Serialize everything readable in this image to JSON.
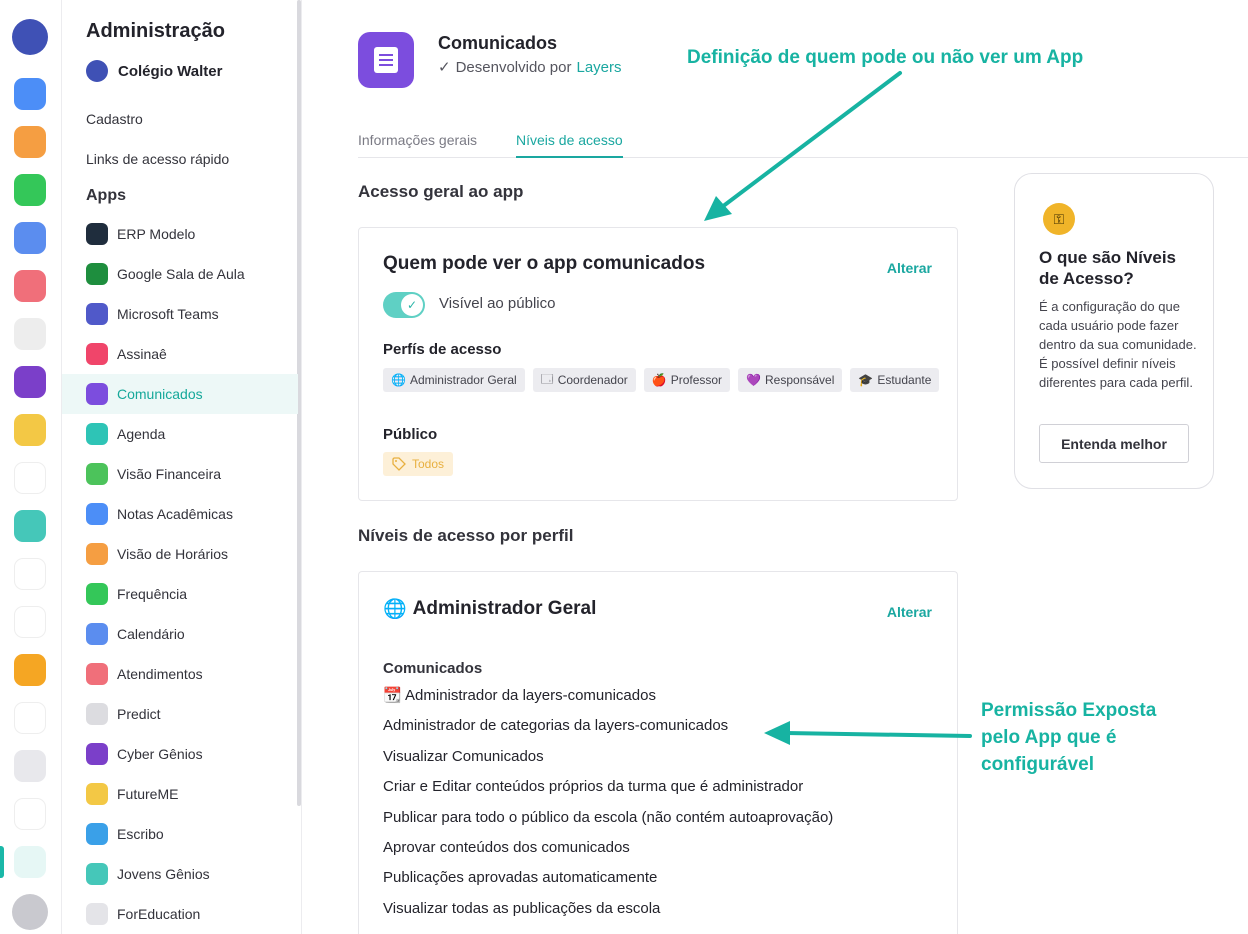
{
  "rail": {
    "icons": [
      {
        "name": "school-switch-icon",
        "color": "#3f51b5"
      },
      {
        "name": "star-app-icon",
        "color": "#4c8ef7"
      },
      {
        "name": "clock-app-icon",
        "color": "#f59e42"
      },
      {
        "name": "check-app-icon",
        "color": "#34c759"
      },
      {
        "name": "calendar-app-icon",
        "color": "#5b8def"
      },
      {
        "name": "chat-app-icon",
        "color": "#f06f7a"
      },
      {
        "name": "predict-app-icon",
        "color": "#ededed"
      },
      {
        "name": "cyber-app-icon",
        "color": "#7b3fc9"
      },
      {
        "name": "futureme-app-icon",
        "color": "#f3c845"
      },
      {
        "name": "play-app-icon",
        "color": "#ffffff"
      },
      {
        "name": "jovens-app-icon",
        "color": "#45c7b9"
      },
      {
        "name": "foreducation-app-icon",
        "color": "#ffffff"
      },
      {
        "name": "redigir-app-icon",
        "color": "#ffffff"
      },
      {
        "name": "arrow-app-icon",
        "color": "#f5a623"
      },
      {
        "name": "orbit-app-icon",
        "color": "#ffffff"
      },
      {
        "name": "folder-icon",
        "color": "#e8e8ec"
      },
      {
        "name": "apps-grid-icon",
        "color": "#ffffff"
      },
      {
        "name": "gear-icon",
        "color": "#e6f7f5"
      },
      {
        "name": "avatar-icon",
        "color": "#c9c9cf"
      }
    ]
  },
  "sidebar": {
    "title": "Administração",
    "school": "Colégio Walter",
    "links": [
      "Cadastro",
      "Links de acesso rápido"
    ],
    "apps_heading": "Apps",
    "apps": [
      {
        "label": "ERP Modelo",
        "color": "#1f2d3d"
      },
      {
        "label": "Google Sala de Aula",
        "color": "#1e8e3e"
      },
      {
        "label": "Microsoft Teams",
        "color": "#5059c9"
      },
      {
        "label": "Assinaê",
        "color": "#f0456a"
      },
      {
        "label": "Comunicados",
        "color": "#7c4dde"
      },
      {
        "label": "Agenda",
        "color": "#2ec4b6"
      },
      {
        "label": "Visão Financeira",
        "color": "#4cc35b"
      },
      {
        "label": "Notas Acadêmicas",
        "color": "#4c8ef7"
      },
      {
        "label": "Visão de Horários",
        "color": "#f59e42"
      },
      {
        "label": "Frequência",
        "color": "#34c759"
      },
      {
        "label": "Calendário",
        "color": "#5b8def"
      },
      {
        "label": "Atendimentos",
        "color": "#f06f7a"
      },
      {
        "label": "Predict",
        "color": "#dcdce0"
      },
      {
        "label": "Cyber Gênios",
        "color": "#7b3fc9"
      },
      {
        "label": "FutureME",
        "color": "#f3c845"
      },
      {
        "label": "Escribo",
        "color": "#3aa0e8"
      },
      {
        "label": "Jovens Gênios",
        "color": "#45c7b9"
      },
      {
        "label": "ForEducation",
        "color": "#e4e4e8"
      }
    ],
    "active_index": 4
  },
  "header": {
    "app_name": "Comunicados",
    "dev_prefix": "Desenvolvido por",
    "dev_link": "Layers",
    "check": "✓"
  },
  "tabs": [
    "Informações gerais",
    "Níveis de acesso"
  ],
  "general": {
    "heading": "Acesso geral ao app",
    "card_title": "Quem pode ver o app comunicados",
    "change": "Alterar",
    "toggle_label": "Visível ao público",
    "profiles_heading": "Perfís de acesso",
    "profiles": [
      {
        "icon": "🌐",
        "label": "Administrador Geral"
      },
      {
        "icon": "🗔",
        "label": "Coordenador"
      },
      {
        "icon": "🍎",
        "label": "Professor"
      },
      {
        "icon": "💜",
        "label": "Responsável"
      },
      {
        "icon": "🎓",
        "label": "Estudante"
      }
    ],
    "public_heading": "Público",
    "public_chip": "Todos"
  },
  "by_profile": {
    "heading": "Níveis de acesso por perfil",
    "card_icon": "🌐",
    "card_title": "Administrador Geral",
    "change": "Alterar",
    "group": "Comunicados",
    "permissions": [
      "📆 Administrador da layers-comunicados",
      "Administrador de categorias da layers-comunicados",
      "Visualizar Comunicados",
      "Criar e Editar conteúdos próprios da turma que é administrador",
      "Publicar para todo o público da escola (não contém autoaprovação)",
      "Aprovar conteúdos dos comunicados",
      "Publicações aprovadas automaticamente",
      "Visualizar todas as publicações da escola"
    ]
  },
  "help": {
    "title": "O que são Níveis de Acesso?",
    "text": "É a configuração do que cada usuário pode fazer dentro da sua comunidade. É possível definir níveis diferentes para cada perfil.",
    "button": "Entenda melhor"
  },
  "annotations": {
    "top": "Definição de quem pode ou não ver um App",
    "side_line1": "Permissão Exposta",
    "side_line2": "pelo App que é",
    "side_line3": "configurável",
    "color": "#17b3a2"
  }
}
